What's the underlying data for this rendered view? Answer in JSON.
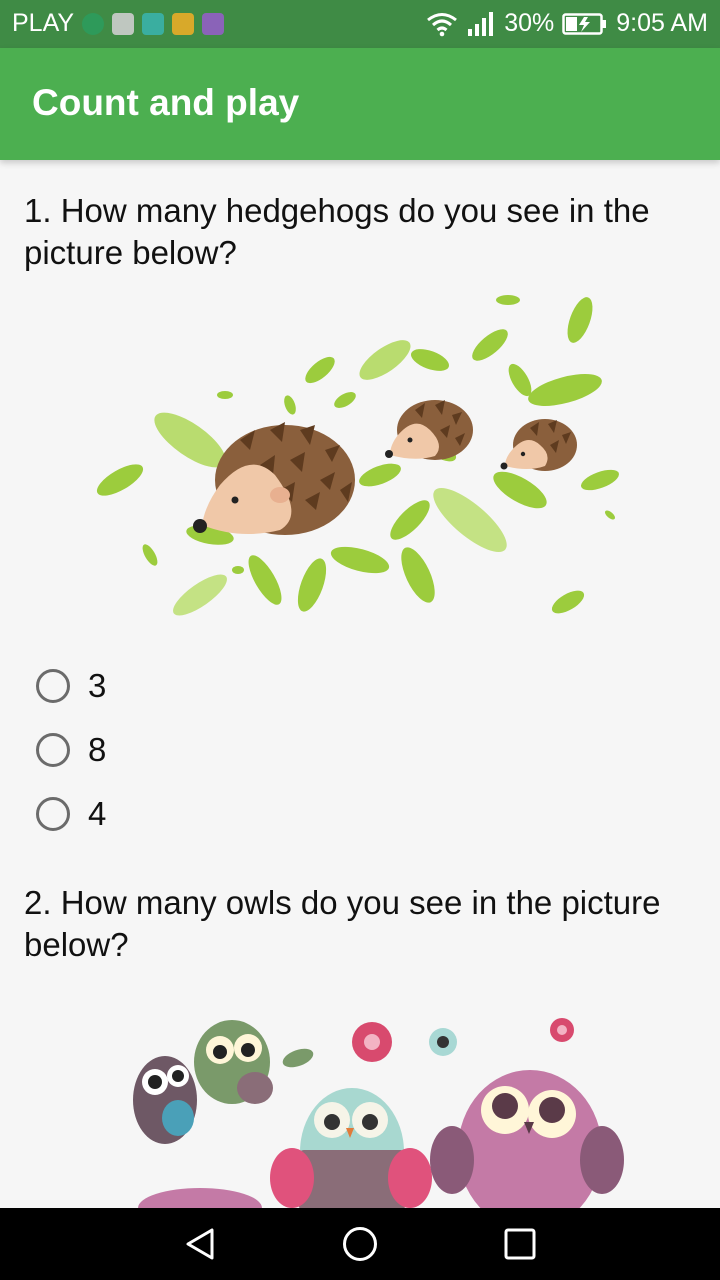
{
  "status_bar": {
    "carrier": "PLAY",
    "battery_percent": "30%",
    "time": "9:05 AM",
    "icons": [
      "globe-icon",
      "mail-icon",
      "android-icon",
      "lock-icon",
      "image-icon",
      "wifi-icon",
      "signal-icon",
      "battery-charging-icon"
    ]
  },
  "app_bar": {
    "title": "Count and play"
  },
  "questions": [
    {
      "text": "1. How many hedgehogs do you see in the picture below?",
      "image": "hedgehogs-illustration",
      "options": [
        "3",
        "8",
        "4"
      ],
      "selected": null
    },
    {
      "text": "2. How many owls do you see in the picture below?",
      "image": "owls-illustration"
    }
  ],
  "nav_bar": {
    "icons": [
      "back-icon",
      "home-icon",
      "recents-icon"
    ]
  },
  "colors": {
    "status_bar": "#3f8b45",
    "app_bar": "#4caf50",
    "background": "#f6f6f6"
  }
}
